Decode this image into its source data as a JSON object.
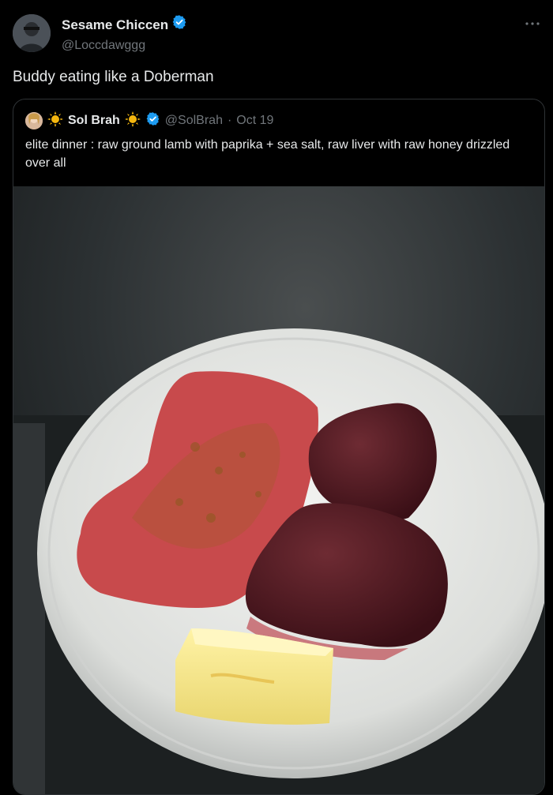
{
  "tweet": {
    "display_name": "Sesame Chiccen",
    "handle": "@Loccdawggg",
    "text": "Buddy eating like a Doberman"
  },
  "quoted": {
    "display_name": "Sol Brah",
    "handle": "@SolBrah",
    "separator": "·",
    "date": "Oct 19",
    "text": "elite dinner : raw ground lamb with paprika + sea salt, raw liver with raw honey drizzled over all"
  },
  "colors": {
    "background": "#000000",
    "text_primary": "#e7e9ea",
    "text_secondary": "#71767b",
    "border": "#2f3336",
    "verified_blue": "#1d9bf0"
  },
  "icons": [
    "verified-badge-icon",
    "more-options-icon",
    "sun-emoji-icon"
  ]
}
